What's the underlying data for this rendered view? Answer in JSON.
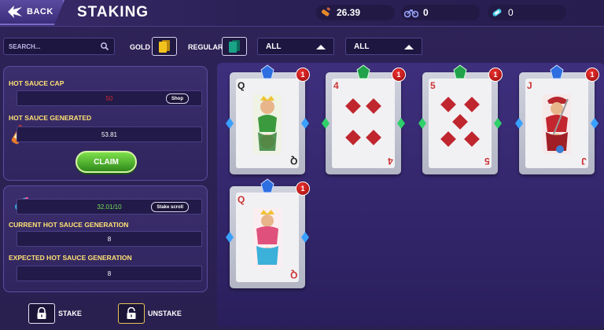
{
  "header": {
    "back_label": "BACK",
    "title": "STAKING",
    "resource1_value": "26.39",
    "resource2_value": "0",
    "resource3_value": "0"
  },
  "filters": {
    "search_placeholder": "SEARCH...",
    "gold_label": "GOLD",
    "regular_label": "REGULAR",
    "dropdown1_value": "ALL",
    "dropdown2_value": "ALL"
  },
  "cap_panel": {
    "cap_label": "HOT SAUCE CAP",
    "cap_value": "50",
    "shop_label": "Shop",
    "generated_label": "HOT SAUCE GENERATED",
    "generated_value": "53.81",
    "claim_label": "CLAIM"
  },
  "generation_panel": {
    "scroll_value": "32.01/10",
    "stake_scroll_label": "Stake scroll",
    "current_label": "CURRENT HOT SAUCE GENERATION",
    "current_value": "8",
    "expected_label": "EXPECTED HOT SAUCE GENERATION",
    "expected_value": "8"
  },
  "actions": {
    "stake_label": "STAKE",
    "unstake_label": "UNSTAKE"
  },
  "cards": [
    {
      "rank": "Q",
      "suit": "clubs",
      "gem": "blue",
      "badge": "1"
    },
    {
      "rank": "4",
      "suit": "diamonds",
      "gem": "green",
      "badge": "1"
    },
    {
      "rank": "5",
      "suit": "diamonds",
      "gem": "green",
      "badge": "1"
    },
    {
      "rank": "J",
      "suit": "hearts",
      "gem": "blue",
      "badge": "1"
    },
    {
      "rank": "Q",
      "suit": "diamonds",
      "gem": "blue",
      "badge": "1"
    }
  ],
  "colors": {
    "accent_yellow": "#ffe173",
    "claim_green": "#5cc23a",
    "scroll_value_green": "#6fe04f",
    "cap_value_red": "#d8262e"
  }
}
